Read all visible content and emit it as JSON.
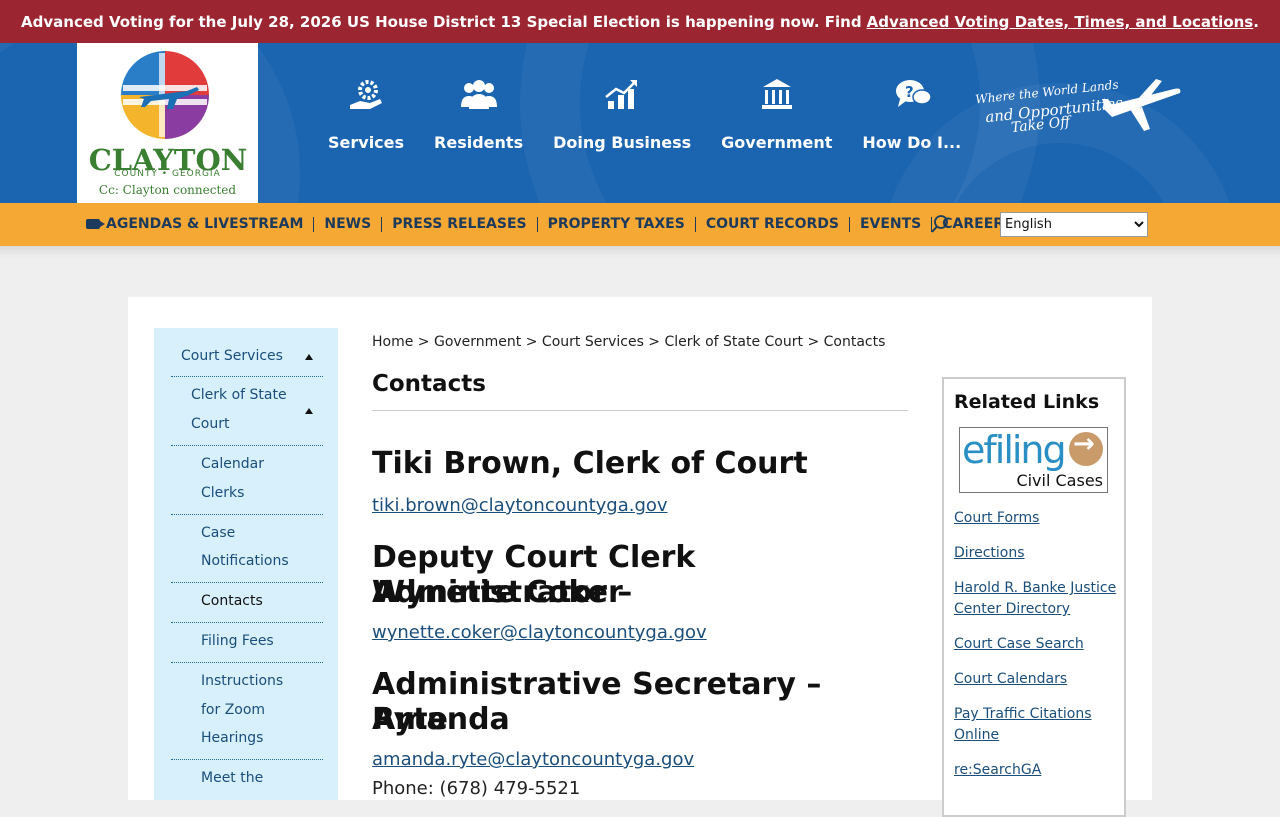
{
  "alert": {
    "text": "Advanced Voting for the July 28, 2026 US House District 13 Special Election is happening now. Find",
    "link": "Advanced Voting Dates, Times, and Locations",
    "suffix": "."
  },
  "logo": {
    "name": "CLAYTON",
    "sub": "COUNTY • GEORGIA",
    "tagline": "Cc: Clayton connected"
  },
  "main_nav": [
    {
      "label": "Services",
      "icon": "gear-hand-icon"
    },
    {
      "label": "Residents",
      "icon": "people-icon"
    },
    {
      "label": "Doing Business",
      "icon": "growth-chart-icon"
    },
    {
      "label": "Government",
      "icon": "capitol-building-icon"
    },
    {
      "label": "How Do I...",
      "icon": "question-bubbles-icon"
    }
  ],
  "header_tagline": {
    "line1": "Where the World Lands",
    "line2": "and Opportunities",
    "line3": "Take Off"
  },
  "sub_nav": [
    "AGENDAS & LIVESTREAM",
    "NEWS",
    "PRESS RELEASES",
    "PROPERTY TAXES",
    "COURT RECORDS",
    "EVENTS",
    "CAREERS"
  ],
  "language": {
    "selected": "English"
  },
  "side_menu": {
    "court_services": "Court Services",
    "clerk_line1": "Clerk of State",
    "clerk_line2": "Court",
    "calendar_line1": "Calendar",
    "calendar_line2": "Clerks",
    "case_line1": "Case",
    "case_line2": "Notifications",
    "contacts": "Contacts",
    "filing_fees": "Filing Fees",
    "zoom_line1": "Instructions",
    "zoom_line2": "for Zoom",
    "zoom_line3": "Hearings",
    "meet": "Meet the"
  },
  "breadcrumb": "Home > Government > Court Services > Clerk of State Court > Contacts",
  "page_title": "Contacts",
  "contacts": [
    {
      "name": "Tiki Brown, Clerk of Court",
      "email": "tiki.brown@claytoncountyga.gov"
    },
    {
      "name_line1": "Deputy Court Clerk Administrator –",
      "name_line2": "Wynette Coker",
      "email": "wynette.coker@claytoncountyga.gov"
    },
    {
      "name_line1": "Administrative Secretary – Amanda",
      "name_line2": "Ryte",
      "email": "amanda.ryte@claytoncountyga.gov",
      "phone": "Phone: (678) 479-5521"
    }
  ],
  "related": {
    "title": "Related Links",
    "efiling_word": "efiling",
    "efiling_sub": "Civil Cases",
    "links": [
      "Court Forms",
      "Directions",
      "Harold R. Banke Justice Center Directory",
      "Court Case Search",
      "Court Calendars",
      "Pay Traffic Citations Online",
      "re:SearchGA"
    ]
  }
}
